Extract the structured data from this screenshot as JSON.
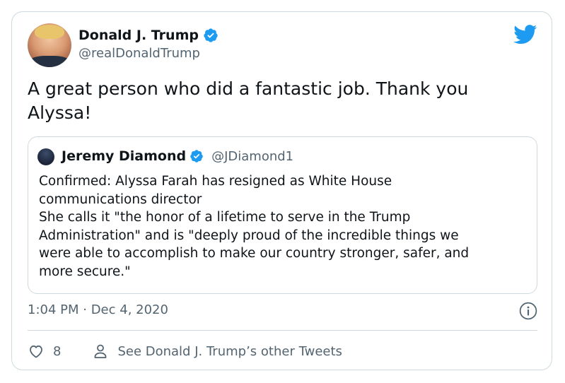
{
  "author": {
    "display_name": "Donald J. Trump",
    "handle": "@realDonaldTrump"
  },
  "tweet": {
    "text_line1": "A great person who did a fantastic job. Thank you",
    "text_line2": "Alyssa!"
  },
  "quoted_tweet": {
    "display_name": "Jeremy Diamond",
    "handle": "@JDiamond1",
    "lines": [
      "Confirmed: Alyssa Farah has resigned as White House",
      "communications director",
      "She calls it \"the honor of a lifetime to serve in the Trump",
      "Administration\" and is \"deeply proud of the incredible things we",
      "were able to accomplish to make our country stronger, safer, and",
      "more secure.\""
    ]
  },
  "meta": {
    "timestamp": "1:04 PM · Dec 4, 2020"
  },
  "actions": {
    "like_count": "8",
    "other_tweets_label": "See Donald J. Trump’s other Tweets"
  },
  "colors": {
    "twitter_blue": "#1d9bf0",
    "secondary_text": "#536471",
    "border": "#cfd9de"
  },
  "icons": {
    "brand": "twitter-bird-icon",
    "verified": "verified-badge-icon",
    "info": "info-icon",
    "like": "heart-icon",
    "profile": "person-icon"
  }
}
